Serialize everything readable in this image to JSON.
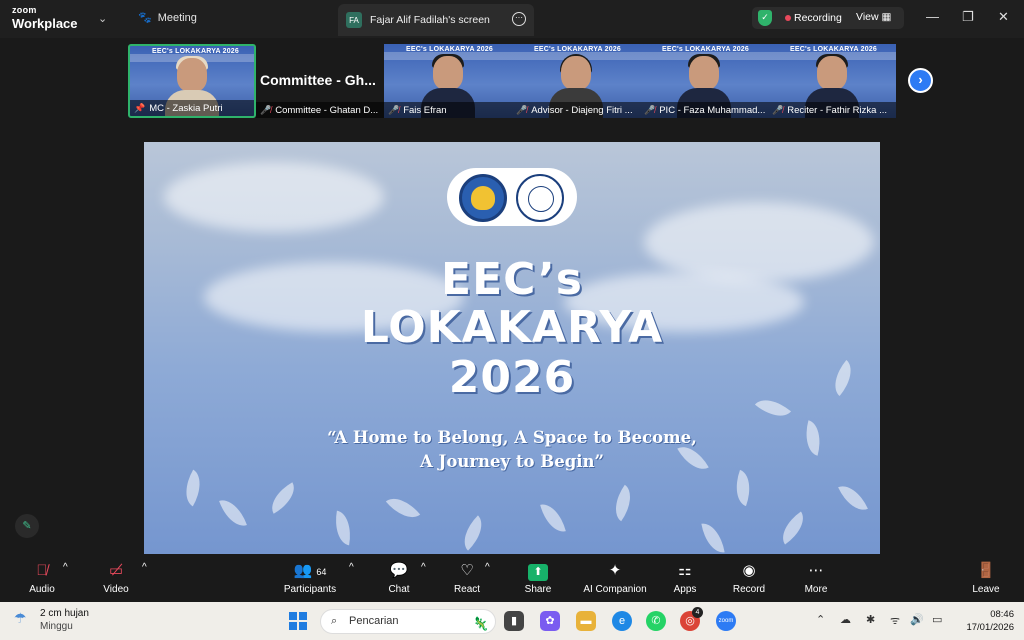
{
  "app": {
    "brand_top": "zoom",
    "brand_bottom": "Workplace",
    "meeting_label": "Meeting"
  },
  "screen_tab": {
    "badge": "FA",
    "label": "Fajar Alif Fadilah's screen"
  },
  "recording": {
    "label": "Recording",
    "view_label": "View"
  },
  "participants": [
    {
      "name": "MC - Zaskia Putri",
      "banner": "EEC's LOKAKARYA 2026",
      "active": true
    },
    {
      "name": "Committee - Ghatan D...",
      "big_name": "Committee  -  Gh..."
    },
    {
      "name": "Fais Efran",
      "banner": "EEC's LOKAKARYA 2026"
    },
    {
      "name": "Advisor - Diajeng Fitri ...",
      "banner": "EEC's LOKAKARYA 2026"
    },
    {
      "name": "PIC - Faza Muhammad...",
      "banner": "EEC's LOKAKARYA 2026"
    },
    {
      "name": "Reciter - Fathir Rizka ...",
      "banner": "EEC's LOKAKARYA 2026"
    }
  ],
  "slide": {
    "title_lines": [
      "EEC’s",
      "LOKAKARYA",
      "2026"
    ],
    "tagline_lines": [
      "“A Home to Belong, A Space to Become,",
      "A Journey to Begin”"
    ]
  },
  "toolbar": {
    "audio": "Audio",
    "video": "Video",
    "participants": "Participants",
    "participants_count": "64",
    "chat": "Chat",
    "react": "React",
    "share": "Share",
    "ai_companion": "AI Companion",
    "apps": "Apps",
    "record": "Record",
    "more": "More",
    "leave": "Leave"
  },
  "taskbar": {
    "weather_temp": "2 cm hujan",
    "weather_sub": "Minggu",
    "search_placeholder": "Pencarian",
    "time": "08:46",
    "date": "17/01/2026",
    "chrome_badge": "4"
  },
  "colors": {
    "accent_green": "#2fb36b",
    "zoom_blue": "#2d7bf4",
    "rec_red": "#e8495c"
  }
}
